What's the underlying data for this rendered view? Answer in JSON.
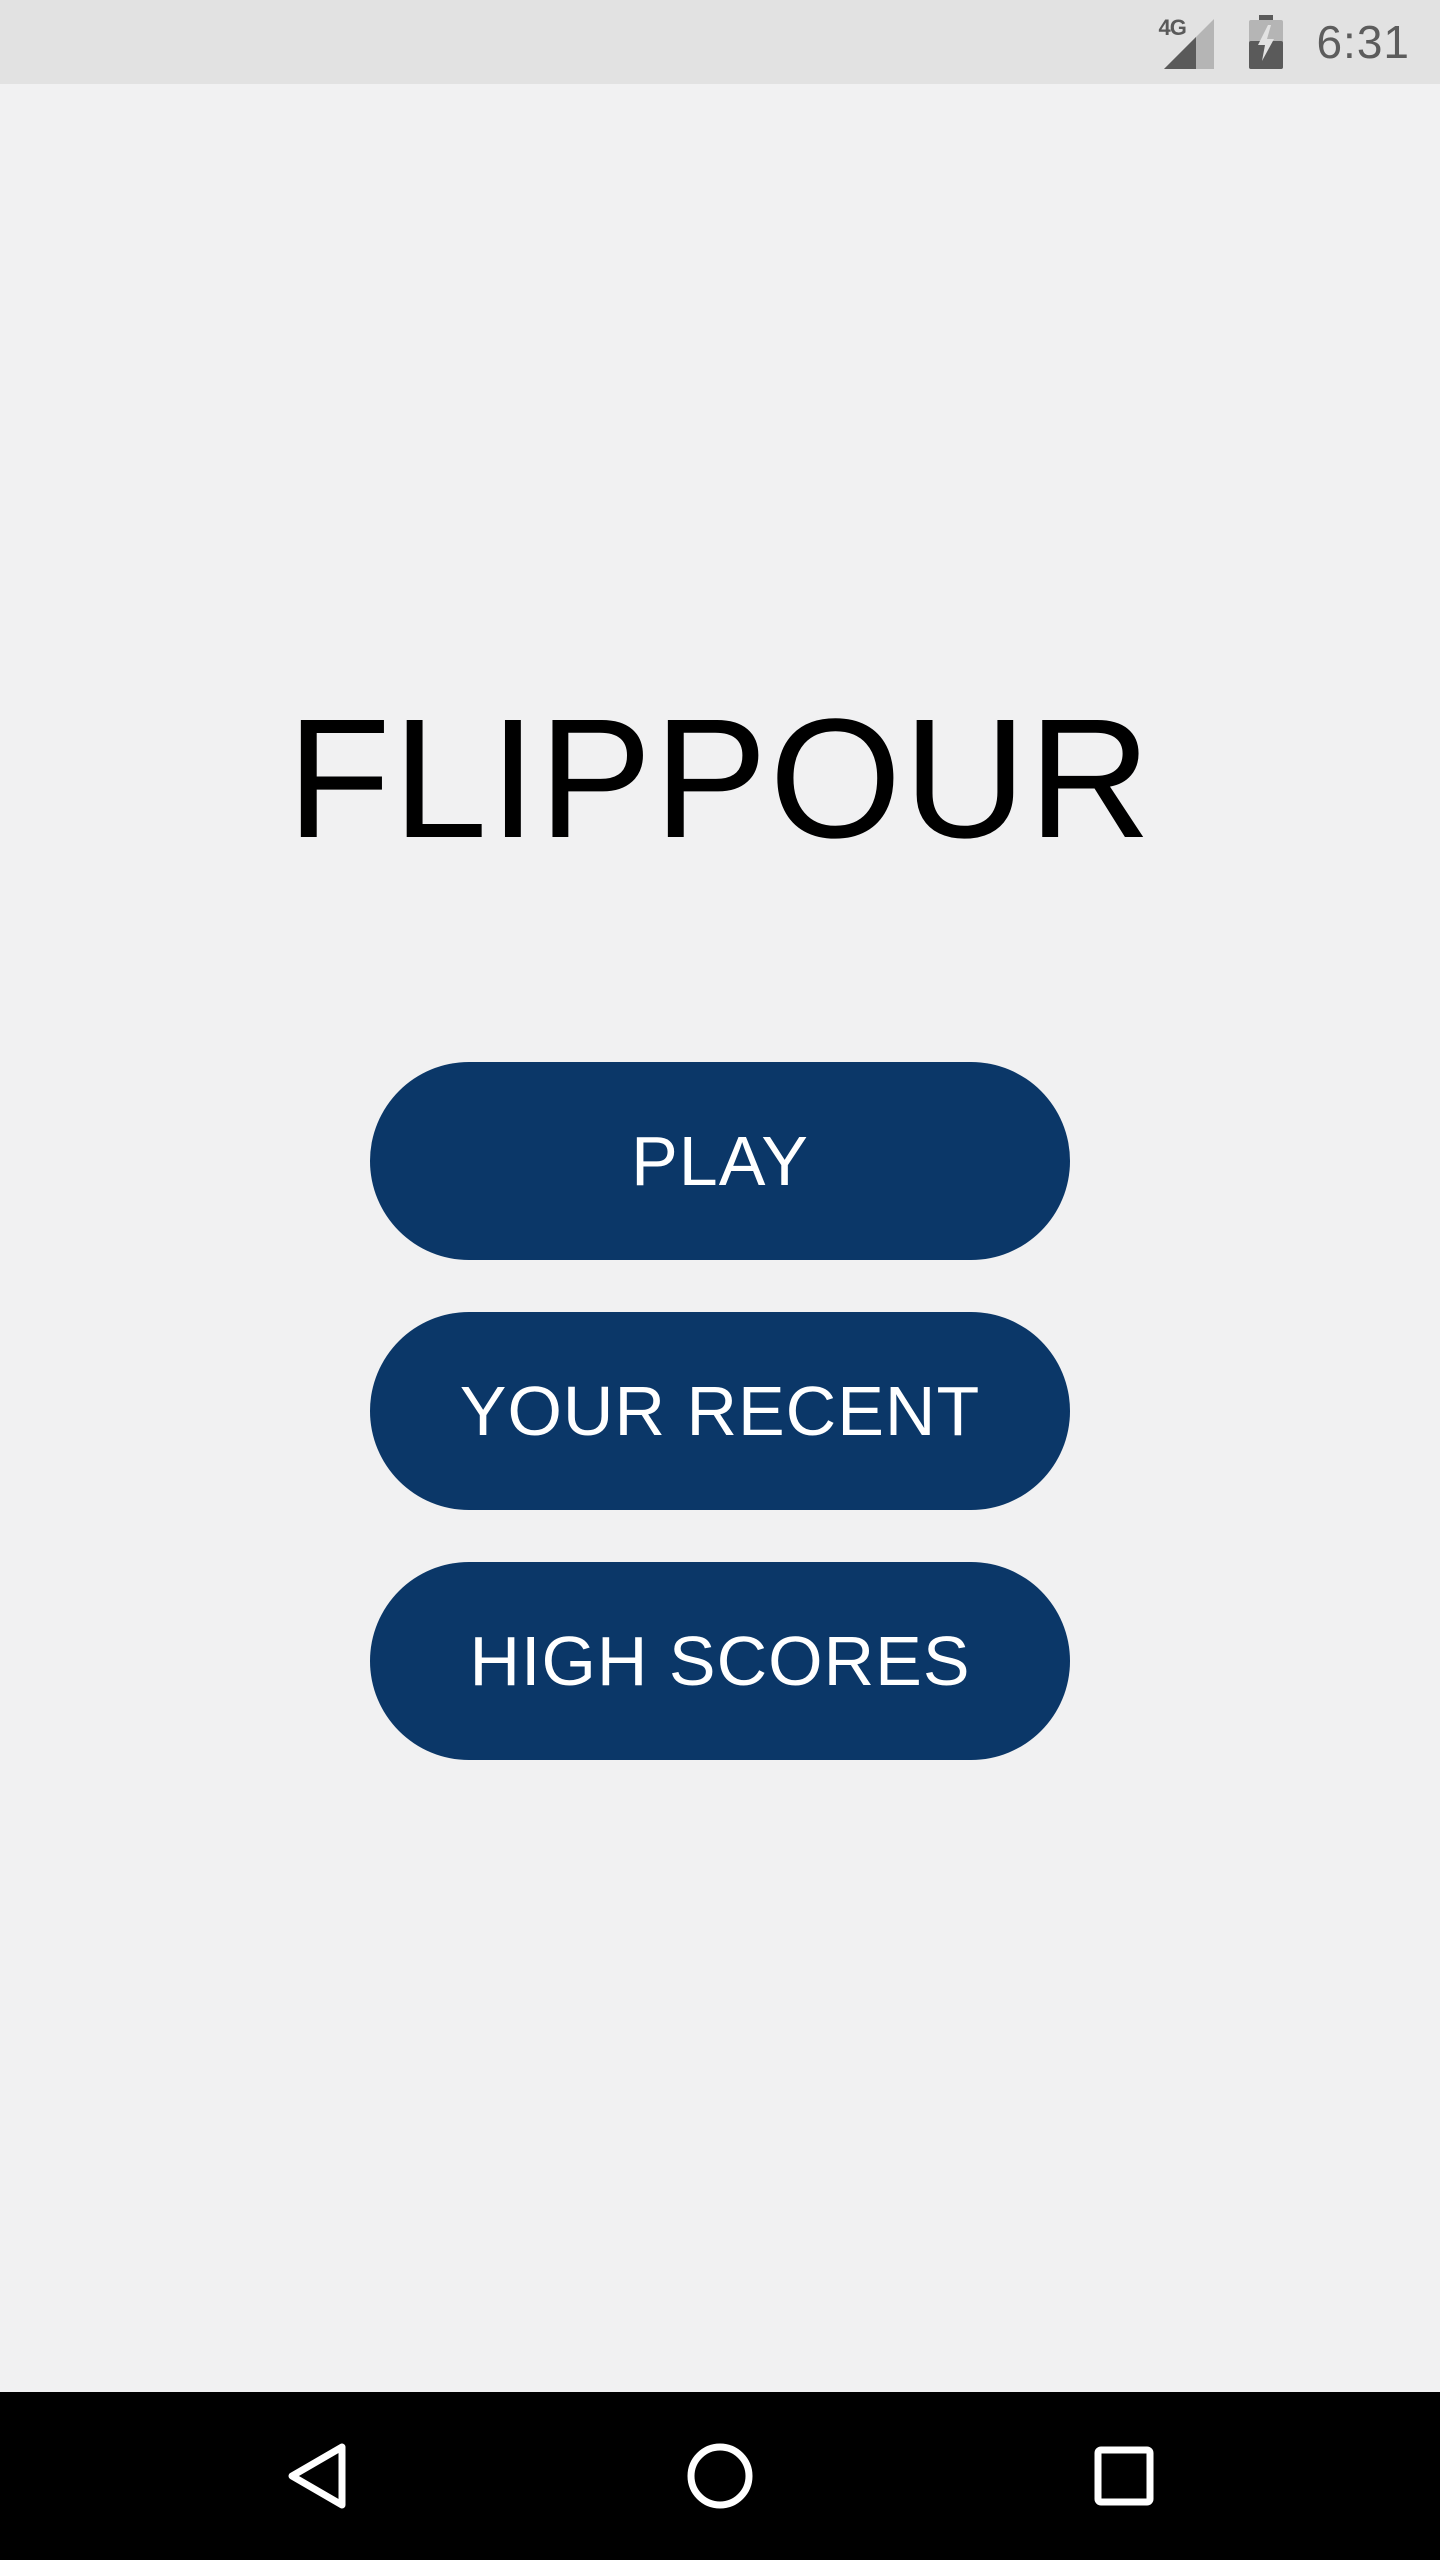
{
  "status_bar": {
    "network": "4G",
    "time": "6:31"
  },
  "app": {
    "title": "FLIPPOUR"
  },
  "menu": {
    "play_label": "PLAY",
    "recent_label": "YOUR RECENT",
    "high_scores_label": "HIGH SCORES"
  },
  "colors": {
    "background": "#f1f1f2",
    "status_bar": "#e2e2e2",
    "button": "#0b3768",
    "button_text": "#ffffff",
    "nav_bar": "#000000"
  },
  "icons": {
    "signal": "signal-icon",
    "battery": "battery-charging-icon",
    "back": "back-triangle-icon",
    "home": "home-circle-icon",
    "recents": "recents-square-icon"
  }
}
